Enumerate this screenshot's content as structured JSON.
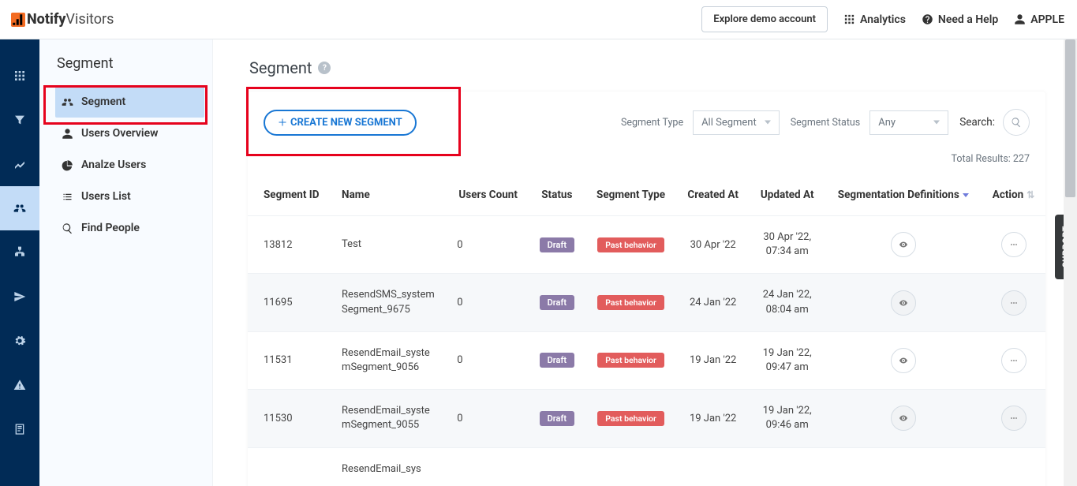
{
  "header": {
    "logo_brand_a": "Notify",
    "logo_brand_b": "Visitors",
    "explore_btn": "Explore demo account",
    "links": {
      "analytics": "Analytics",
      "help": "Need a Help",
      "user": "APPLE"
    }
  },
  "sidebar": {
    "title": "Segment",
    "items": [
      {
        "label": "Segment"
      },
      {
        "label": "Users Overview"
      },
      {
        "label": "Analze Users"
      },
      {
        "label": "Users List"
      },
      {
        "label": "Find People"
      }
    ]
  },
  "page": {
    "title": "Segment",
    "create_btn": "CREATE NEW SEGMENT",
    "filters": {
      "type_label": "Segment Type",
      "type_value": "All Segment",
      "status_label": "Segment Status",
      "status_value": "Any",
      "search_label": "Search:"
    },
    "total_results": "Total Results: 227",
    "columns": {
      "id": "Segment ID",
      "name": "Name",
      "users": "Users Count",
      "status": "Status",
      "type": "Segment Type",
      "created": "Created At",
      "updated": "Updated At",
      "defs": "Segmentation Definitions",
      "action": "Action"
    },
    "rows": [
      {
        "id": "13812",
        "name": "Test",
        "users": "0",
        "status": "Draft",
        "type": "Past behavior",
        "created": "30 Apr '22",
        "updated_l1": "30 Apr '22,",
        "updated_l2": "07:34 am"
      },
      {
        "id": "11695",
        "name": "ResendSMS_systemSegment_9675",
        "users": "0",
        "status": "Draft",
        "type": "Past behavior",
        "created": "24 Jan '22",
        "updated_l1": "24 Jan '22,",
        "updated_l2": "08:04 am"
      },
      {
        "id": "11531",
        "name": "ResendEmail_systemSegment_9056",
        "users": "0",
        "status": "Draft",
        "type": "Past behavior",
        "created": "19 Jan '22",
        "updated_l1": "19 Jan '22,",
        "updated_l2": "09:47 am"
      },
      {
        "id": "11530",
        "name": "ResendEmail_systemSegment_9055",
        "users": "0",
        "status": "Draft",
        "type": "Past behavior",
        "created": "19 Jan '22",
        "updated_l1": "19 Jan '22,",
        "updated_l2": "09:46 am"
      },
      {
        "id": "",
        "name": "ResendEmail_sys",
        "users": "",
        "status": "",
        "type": "",
        "created": "",
        "updated_l1": "",
        "updated_l2": ""
      }
    ]
  },
  "support_tab": "SUPPORT"
}
